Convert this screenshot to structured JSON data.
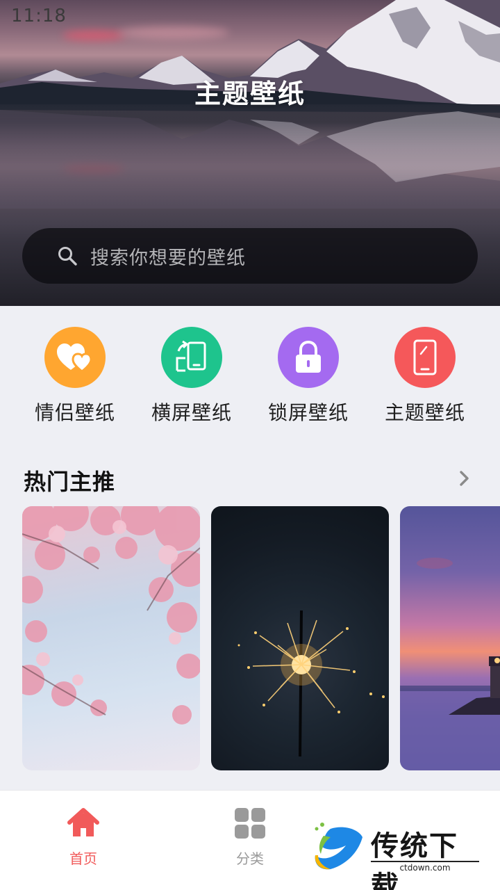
{
  "status_bar": {
    "time": "11:18"
  },
  "header": {
    "title": "主题壁纸"
  },
  "search": {
    "placeholder": "搜索你想要的壁纸"
  },
  "categories": [
    {
      "label": "情侣壁纸",
      "icon": "hearts-icon",
      "color": "#ffa630"
    },
    {
      "label": "横屏壁纸",
      "icon": "rotate-phone-icon",
      "color": "#1ec48d"
    },
    {
      "label": "锁屏壁纸",
      "icon": "lock-icon",
      "color": "#a46af0"
    },
    {
      "label": "主题壁纸",
      "icon": "phone-icon",
      "color": "#f5585a"
    }
  ],
  "hot_section": {
    "title": "热门主推",
    "more_icon": "chevron-right-icon",
    "cards": [
      {
        "subject": "cherry-blossom"
      },
      {
        "subject": "sparkler"
      },
      {
        "subject": "lighthouse-sunset"
      }
    ]
  },
  "tabbar": {
    "items": [
      {
        "label": "首页",
        "icon": "home-icon",
        "active": true,
        "color": "#f15a5a"
      },
      {
        "label": "分类",
        "icon": "grid-icon",
        "active": false,
        "color": "#9a9a9a"
      }
    ]
  },
  "watermark": {
    "text": "传统下载",
    "sub": "ctdown.com"
  }
}
